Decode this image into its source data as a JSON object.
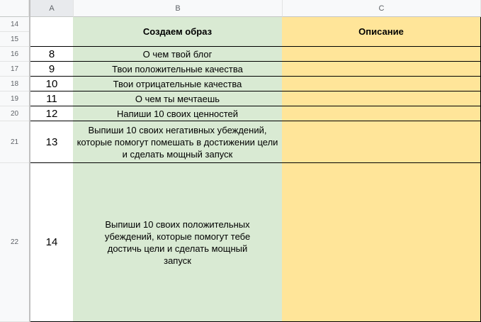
{
  "columns": [
    "A",
    "B",
    "C"
  ],
  "rows": [
    {
      "num": "14"
    },
    {
      "num": "15"
    },
    {
      "num": "16",
      "a": "8",
      "b": "О чем твой блог"
    },
    {
      "num": "17",
      "a": "9",
      "b": "Твои положительные качества"
    },
    {
      "num": "18",
      "a": "10",
      "b": "Твои отрицательные качества"
    },
    {
      "num": "19",
      "a": "11",
      "b": "О чем ты мечтаешь"
    },
    {
      "num": "20",
      "a": "12",
      "b": "Напиши 10 своих ценностей"
    },
    {
      "num": "21",
      "a": "13",
      "b": "Выпиши 10 своих негативных убеждений, которые помогут помешать в достижении цели и сделать мощный запуск"
    },
    {
      "num": "22",
      "a": "14",
      "b": "Выпиши 10 своих положительных убеждений, которые помогут тебе достичь цели и сделать мощный запуск"
    }
  ],
  "header": {
    "b": "Создаем образ",
    "c": "Описание"
  }
}
